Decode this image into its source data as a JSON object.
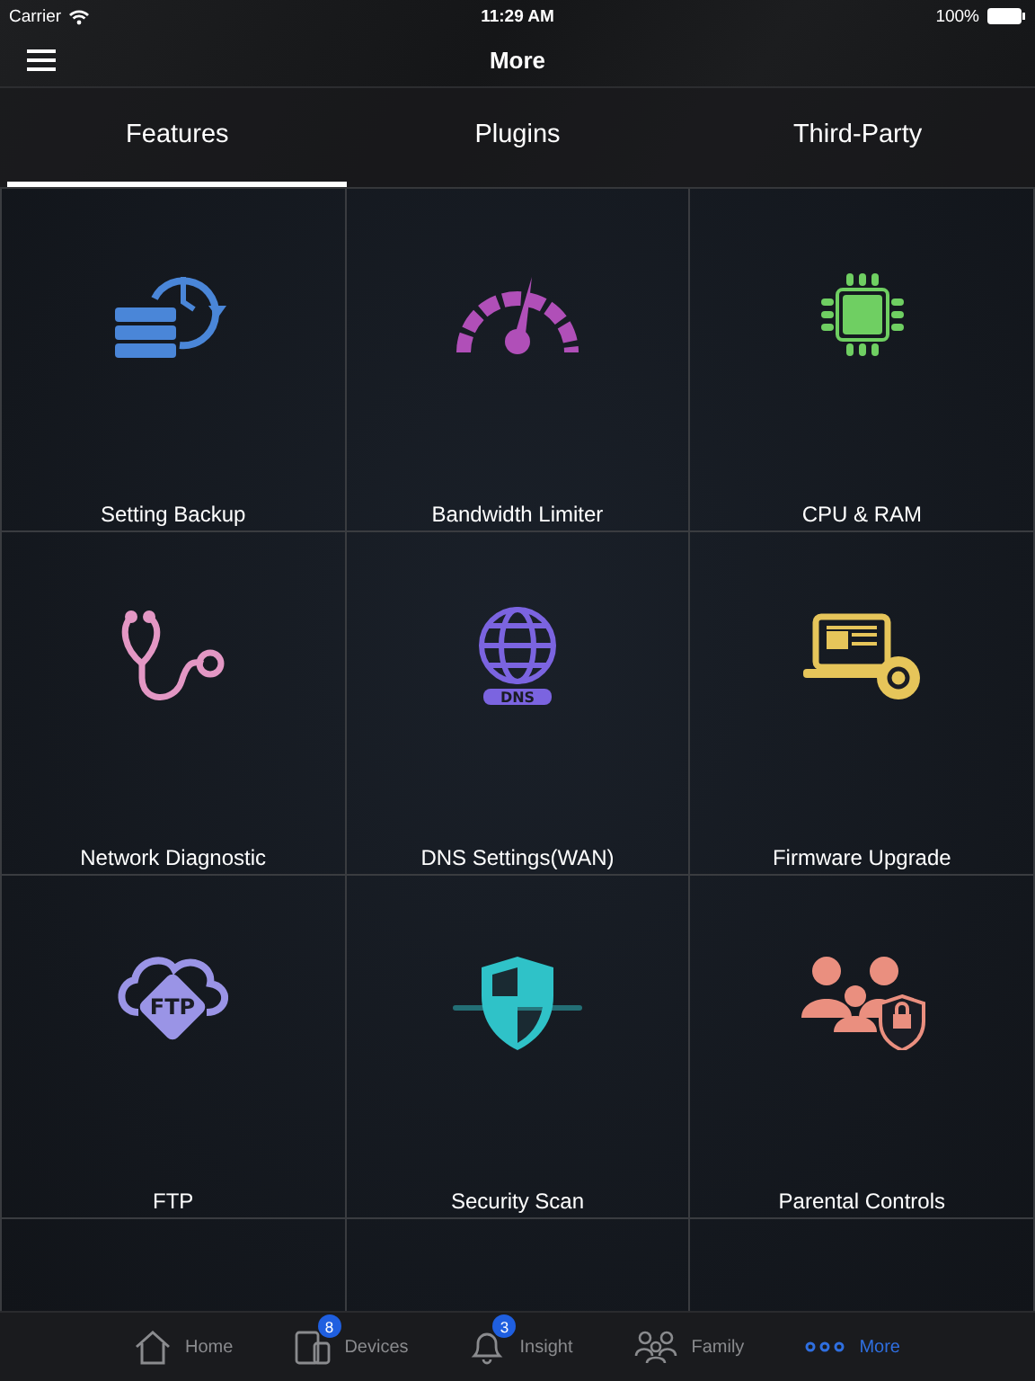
{
  "status_bar": {
    "carrier": "Carrier",
    "time": "11:29 AM",
    "battery": "100%"
  },
  "nav": {
    "title": "More"
  },
  "tabs": [
    {
      "label": "Features",
      "selected": true
    },
    {
      "label": "Plugins",
      "selected": false
    },
    {
      "label": "Third-Party",
      "selected": false
    }
  ],
  "features": [
    {
      "label": "Setting Backup",
      "kind": "backup",
      "color": "#4a86d8"
    },
    {
      "label": "Bandwidth Limiter",
      "kind": "gauge",
      "color": "#b04fb8"
    },
    {
      "label": "CPU & RAM",
      "kind": "chip",
      "color": "#6fcf62"
    },
    {
      "label": "Network Diagnostic",
      "kind": "stethoscope",
      "color": "#e397c4"
    },
    {
      "label": "DNS Settings(WAN)",
      "kind": "globe",
      "color": "#7b64e0",
      "icon_text": "DNS"
    },
    {
      "label": "Firmware Upgrade",
      "kind": "laptop",
      "color": "#e6c55a"
    },
    {
      "label": "FTP",
      "kind": "cloud",
      "color": "#9a94e6",
      "icon_text": "FTP"
    },
    {
      "label": "Security Scan",
      "kind": "shield",
      "color": "#2fc2c8"
    },
    {
      "label": "Parental Controls",
      "kind": "family",
      "color": "#ea8f7f"
    }
  ],
  "bottom_tabs": [
    {
      "label": "Home",
      "kind": "home",
      "selected": false
    },
    {
      "label": "Devices",
      "kind": "devices",
      "badge": "8",
      "selected": false
    },
    {
      "label": "Insight",
      "kind": "bell",
      "badge": "3",
      "selected": false
    },
    {
      "label": "Family",
      "kind": "family",
      "selected": false
    },
    {
      "label": "More",
      "kind": "more",
      "selected": true
    }
  ]
}
